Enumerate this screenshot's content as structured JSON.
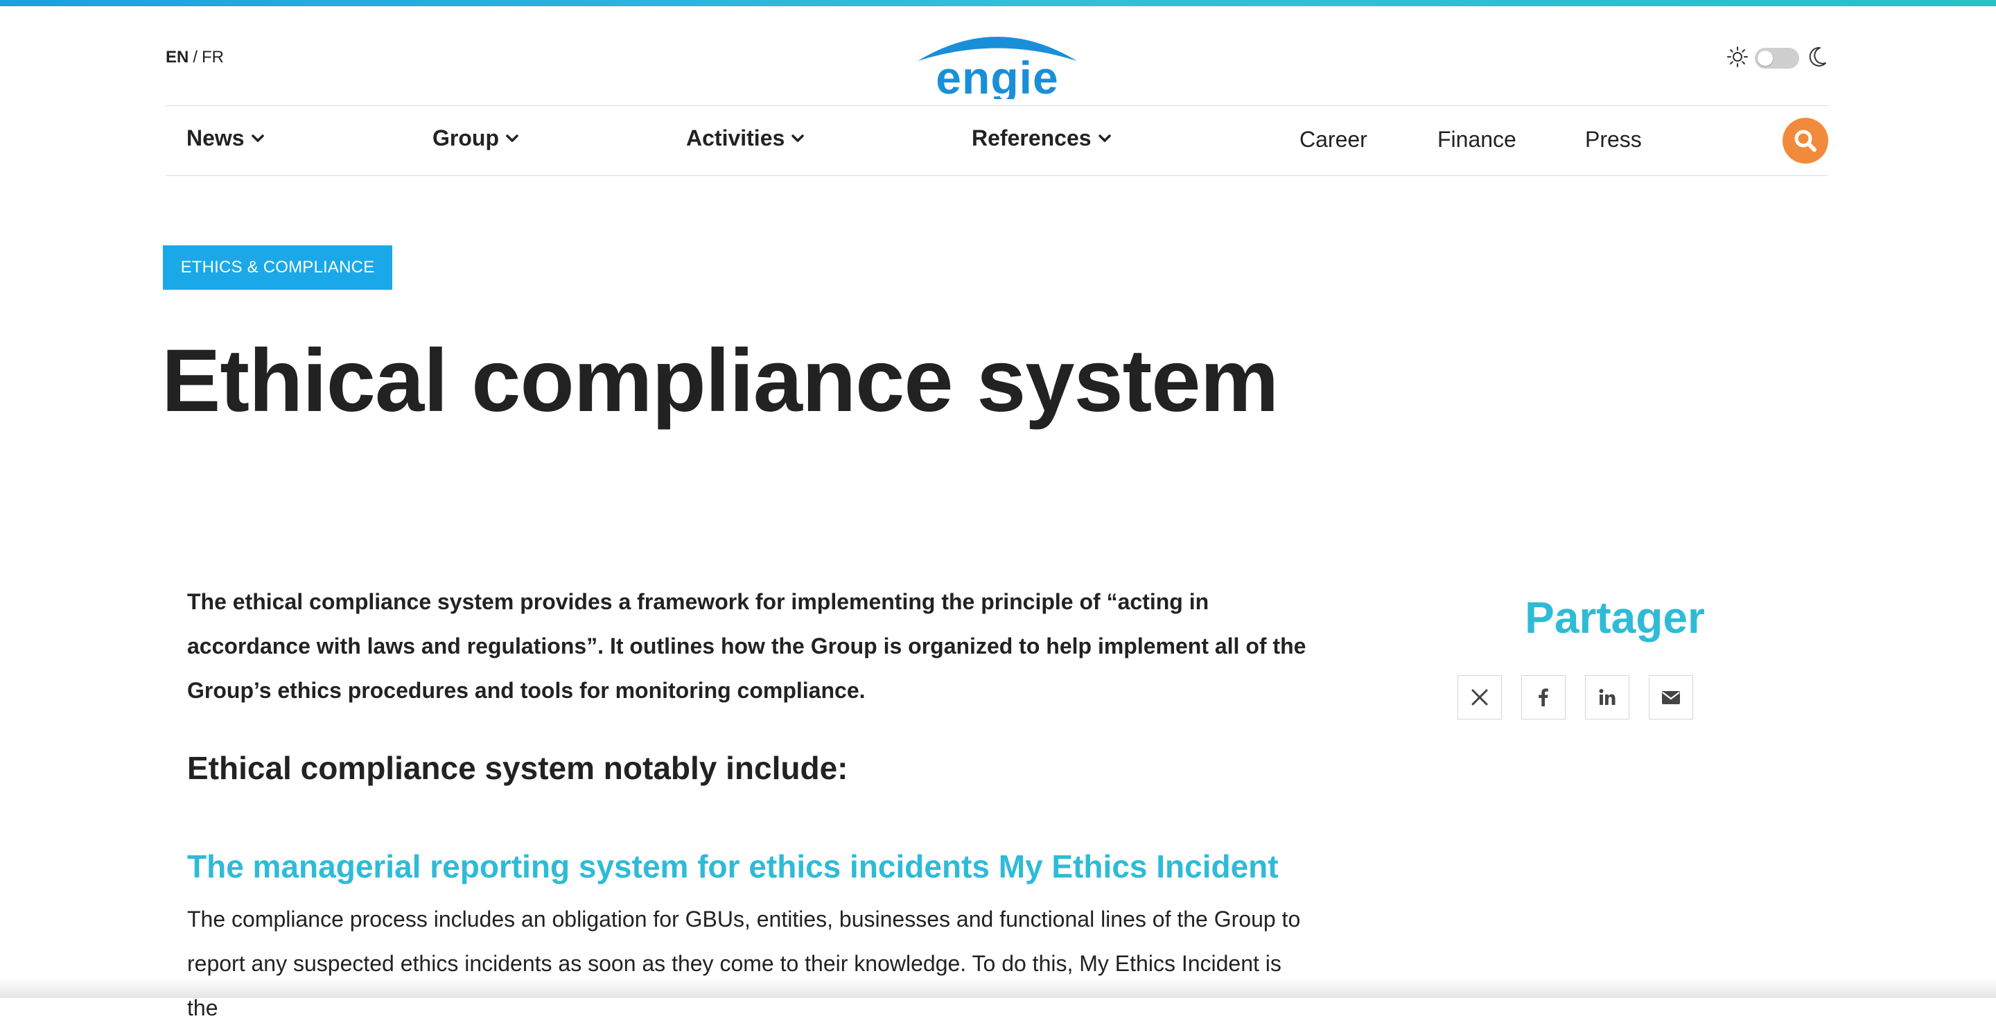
{
  "colors": {
    "accent": "#2ebbd6",
    "badge": "#1ba8e8",
    "search": "#f28a3b",
    "brand": "#1a8fd9"
  },
  "header": {
    "lang_active": "EN",
    "lang_separator": "/",
    "lang_other": "FR",
    "logo_text": "engie",
    "theme_light_icon": "sun-icon",
    "theme_dark_icon": "moon-icon"
  },
  "nav": {
    "dropdowns": [
      {
        "label": "News"
      },
      {
        "label": "Group"
      },
      {
        "label": "Activities"
      },
      {
        "label": "References"
      }
    ],
    "links": [
      {
        "label": "Career"
      },
      {
        "label": "Finance"
      },
      {
        "label": "Press"
      }
    ],
    "search_icon": "search-icon"
  },
  "article": {
    "category": "ETHICS & COMPLIANCE",
    "title": "Ethical compliance system",
    "lead": "The ethical compliance system provides a framework for implementing the principle of “acting in accordance with laws and regulations”. It outlines how the Group is organized to help implement all of the Group’s ethics procedures and tools for monitoring compliance.",
    "subhead": "Ethical compliance system notably include:",
    "section_title": "The managerial reporting system for ethics incidents My Ethics Incident",
    "section_body": "The compliance process includes an obligation for GBUs, entities, businesses and functional lines of the Group to report any suspected ethics incidents as soon as they come to their knowledge. To do this, My Ethics Incident is the"
  },
  "share": {
    "title": "Partager",
    "icons": [
      "x-twitter-icon",
      "facebook-icon",
      "linkedin-icon",
      "email-icon"
    ]
  }
}
